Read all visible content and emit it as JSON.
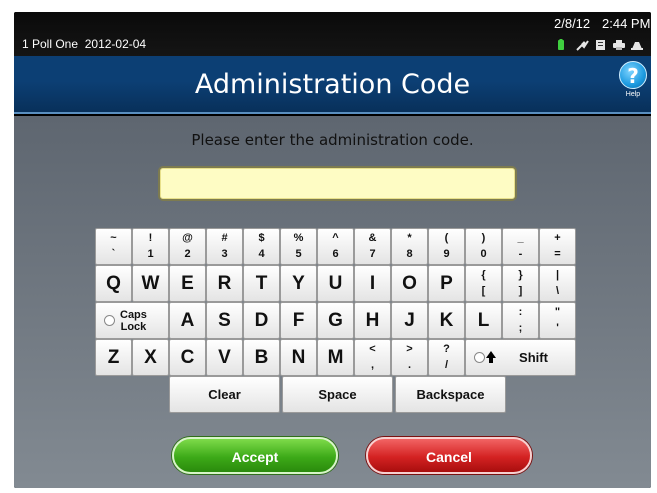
{
  "status_bar": {
    "poll_label": "1 Poll One",
    "poll_date": "2012-02-04",
    "date": "2/8/12",
    "time": "2:44 PM",
    "icons": [
      "battery-icon",
      "power-plug-icon",
      "document-icon",
      "printer-icon",
      "network-icon"
    ]
  },
  "header": {
    "title": "Administration Code",
    "help_label": "Help",
    "help_symbol": "?"
  },
  "prompt": "Please enter the administration code.",
  "code_input": {
    "value": "",
    "placeholder": ""
  },
  "keyboard": {
    "row1": [
      {
        "top": "~",
        "bot": "`"
      },
      {
        "top": "!",
        "bot": "1"
      },
      {
        "top": "@",
        "bot": "2"
      },
      {
        "top": "#",
        "bot": "3"
      },
      {
        "top": "$",
        "bot": "4"
      },
      {
        "top": "%",
        "bot": "5"
      },
      {
        "top": "^",
        "bot": "6"
      },
      {
        "top": "&",
        "bot": "7"
      },
      {
        "top": "*",
        "bot": "8"
      },
      {
        "top": "(",
        "bot": "9"
      },
      {
        "top": ")",
        "bot": "0"
      },
      {
        "top": "_",
        "bot": "-"
      },
      {
        "top": "+",
        "bot": "="
      }
    ],
    "row2_letters": [
      "Q",
      "W",
      "E",
      "R",
      "T",
      "Y",
      "U",
      "I",
      "O",
      "P"
    ],
    "row2_symbols": [
      {
        "top": "{",
        "bot": "["
      },
      {
        "top": "}",
        "bot": "]"
      },
      {
        "top": "|",
        "bot": "\\"
      }
    ],
    "caps_lock": {
      "line1": "Caps",
      "line2": "Lock"
    },
    "row3_letters": [
      "A",
      "S",
      "D",
      "F",
      "G",
      "H",
      "J",
      "K",
      "L"
    ],
    "row3_symbols": [
      {
        "top": ":",
        "bot": ";"
      },
      {
        "top": "\"",
        "bot": "'"
      }
    ],
    "row4_letters": [
      "Z",
      "X",
      "C",
      "V",
      "B",
      "N",
      "M"
    ],
    "row4_symbols": [
      {
        "top": "<",
        "bot": ","
      },
      {
        "top": ">",
        "bot": "."
      },
      {
        "top": "?",
        "bot": "/"
      }
    ],
    "shift_label": "Shift",
    "clear_label": "Clear",
    "space_label": "Space",
    "backspace_label": "Backspace"
  },
  "actions": {
    "accept_label": "Accept",
    "cancel_label": "Cancel"
  },
  "colors": {
    "title_bar": "#0c3f74",
    "input_bg": "#fefcc4",
    "accept": "#3daa18",
    "cancel": "#d42222"
  }
}
